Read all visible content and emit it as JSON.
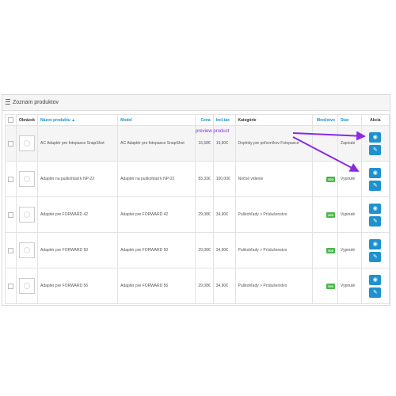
{
  "panel": {
    "title": "Zoznam produktov"
  },
  "table": {
    "headers": {
      "image": "Obrázok",
      "name": "Názov produktu ▲",
      "model": "Model",
      "price": "Cena",
      "incl_tax": "Incl.tax",
      "category": "Kategórie",
      "quantity": "Množstvo",
      "status": "Stav",
      "action": "Akcia"
    },
    "rows": [
      {
        "name": "AC Adaptér pre fotopasce SnapShot",
        "model": "AC Adaptér pre fotopasce SnapShot",
        "price": "16,58€",
        "incl_tax": "19,90€",
        "category": "Doplnky pre poľovníkov Fotopasce",
        "quantity": "",
        "status": "Zapnuté"
      },
      {
        "name": "Adaptér na puškohlad k NP-22",
        "model": "Adaptér na puškohlad k NP-22",
        "price": "83,33€",
        "incl_tax": "100,00€",
        "category": "Nočné videnie",
        "quantity": "500",
        "status": "Vypnuté"
      },
      {
        "name": "Adaptér pre FORWARD 42",
        "model": "Adaptér pre FORWARD 42",
        "price": "29,08€",
        "incl_tax": "34,90€",
        "category": "Puškohľady > Príslušenstvo",
        "quantity": "500",
        "status": "Vypnuté"
      },
      {
        "name": "Adaptér pre FORWARD 50",
        "model": "Adaptér pre FORWARD 50",
        "price": "29,08€",
        "incl_tax": "34,90€",
        "category": "Puškohľady > Príslušenstvo",
        "quantity": "500",
        "status": "Vypnuté"
      },
      {
        "name": "Adaptér pre FORWARD 56",
        "model": "Adaptér pre FORWARD 56",
        "price": "29,08€",
        "incl_tax": "34,90€",
        "category": "Puškohľady > Príslušenstvo",
        "quantity": "500",
        "status": "Vypnuté"
      }
    ]
  },
  "annotation": {
    "text": "preview product",
    "color": "#8a2be2"
  },
  "icons": {
    "view": "eye-icon",
    "edit": "pencil-icon",
    "image": "camera-icon"
  },
  "colors": {
    "primary": "#1e91cf",
    "badge": "#4cb64c"
  }
}
